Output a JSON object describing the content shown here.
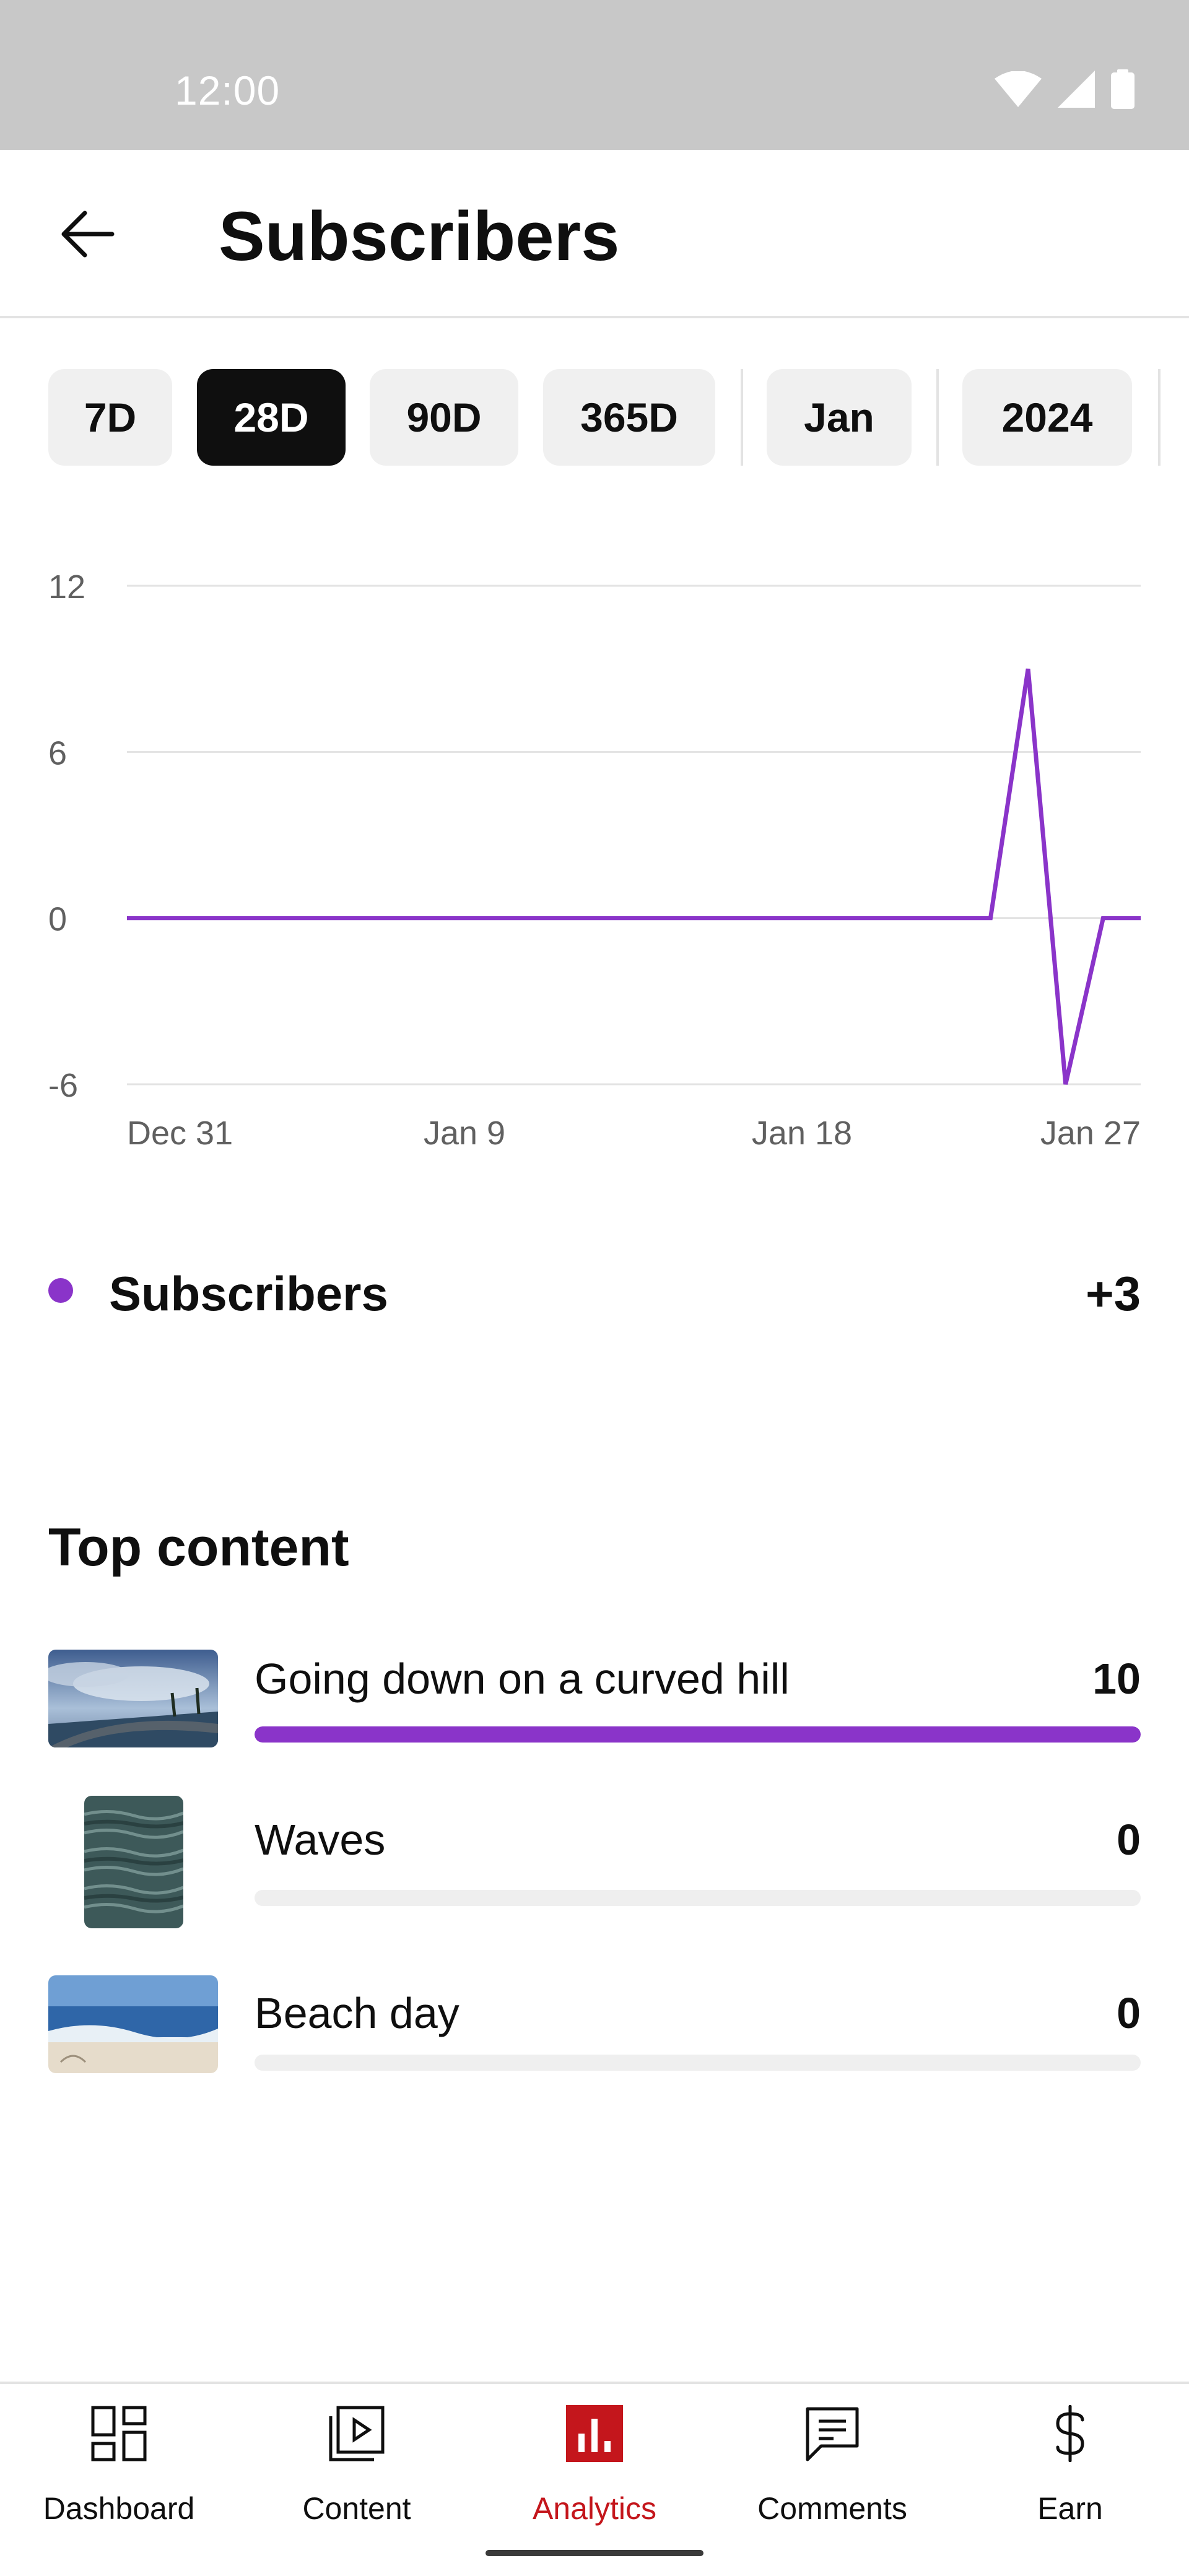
{
  "status_bar": {
    "time": "12:00",
    "icons": [
      "wifi-icon",
      "cell-signal-icon",
      "battery-icon"
    ]
  },
  "header": {
    "back_icon": "arrow-left-icon",
    "title": "Subscribers"
  },
  "filter_chips": [
    {
      "label": "7D",
      "selected": false
    },
    {
      "label": "28D",
      "selected": true
    },
    {
      "label": "90D",
      "selected": false
    },
    {
      "label": "365D",
      "selected": false
    },
    {
      "label": "Jan",
      "selected": false
    },
    {
      "label": "2024",
      "selected": false
    }
  ],
  "chart_data": {
    "type": "line",
    "title": "",
    "xlabel": "",
    "ylabel": "",
    "x_tick_labels": [
      "Dec 31",
      "Jan 9",
      "Jan 18",
      "Jan 27"
    ],
    "y_ticks": [
      12,
      6,
      0,
      -6
    ],
    "ylim": [
      -6,
      12
    ],
    "grid": true,
    "x_start": "Dec 31",
    "x_end": "Jan 27",
    "series": [
      {
        "name": "Subscribers",
        "color": "#8a34c9",
        "values": [
          0,
          0,
          0,
          0,
          0,
          0,
          0,
          0,
          0,
          0,
          0,
          0,
          0,
          0,
          0,
          0,
          0,
          0,
          0,
          0,
          0,
          0,
          0,
          0,
          9,
          -6,
          0,
          0
        ]
      }
    ]
  },
  "legend": {
    "label": "Subscribers",
    "value": "+3",
    "color": "#8a34c9"
  },
  "top_content": {
    "heading": "Top content",
    "items": [
      {
        "title": "Going down on a curved hill",
        "value": "10",
        "fill": 1.0,
        "thumb": "curved-hill-thumbnail"
      },
      {
        "title": "Waves",
        "value": "0",
        "fill": 0.0,
        "thumb": "waves-thumbnail"
      },
      {
        "title": "Beach day",
        "value": "0",
        "fill": 0.0,
        "thumb": "beach-day-thumbnail"
      }
    ]
  },
  "bottom_nav": [
    {
      "label": "Dashboard",
      "icon": "dashboard-icon",
      "active": false
    },
    {
      "label": "Content",
      "icon": "content-icon",
      "active": false
    },
    {
      "label": "Analytics",
      "icon": "analytics-icon",
      "active": true
    },
    {
      "label": "Comments",
      "icon": "comments-icon",
      "active": false
    },
    {
      "label": "Earn",
      "icon": "dollar-icon",
      "active": false
    }
  ],
  "colors": {
    "accent": "#8a34c9",
    "active_nav": "#c4161c"
  }
}
